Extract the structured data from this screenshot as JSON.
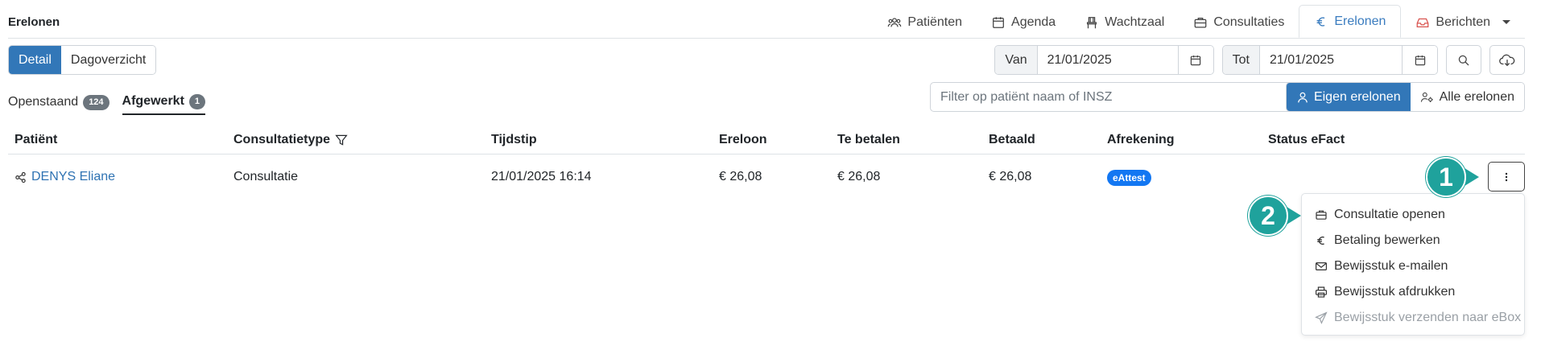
{
  "header": {
    "title": "Erelonen",
    "tabs": [
      {
        "label": "Patiënten",
        "icon": "users-icon",
        "active": false
      },
      {
        "label": "Agenda",
        "icon": "calendar-icon",
        "active": false
      },
      {
        "label": "Wachtzaal",
        "icon": "chair-icon",
        "active": false
      },
      {
        "label": "Consultaties",
        "icon": "briefcase-icon",
        "active": false
      },
      {
        "label": "Erelonen",
        "icon": "euro-icon",
        "active": true
      },
      {
        "label": "Berichten",
        "icon": "inbox-icon",
        "active": false,
        "dropdown": true
      }
    ]
  },
  "view_toggle": {
    "detail": "Detail",
    "dagoverzicht": "Dagoverzicht",
    "selected": "Detail"
  },
  "date_range": {
    "from_label": "Van",
    "from_value": "21/01/2025",
    "to_label": "Tot",
    "to_value": "21/01/2025"
  },
  "subtabs": [
    {
      "label": "Openstaand",
      "count": "124",
      "active": false
    },
    {
      "label": "Afgewerkt",
      "count": "1",
      "active": true
    }
  ],
  "filter": {
    "placeholder": "Filter op patiënt naam of INSZ"
  },
  "ownership": {
    "own_label": "Eigen erelonen",
    "all_label": "Alle erelonen",
    "selected": "Eigen erelonen"
  },
  "table": {
    "headers": [
      "Patiënt",
      "Consultatietype",
      "Tijdstip",
      "Ereloon",
      "Te betalen",
      "Betaald",
      "Afrekening",
      "Status eFact"
    ],
    "rows": [
      {
        "patient": "DENYS Eliane",
        "type": "Consultatie",
        "time": "21/01/2025 16:14",
        "fee": "€ 26,08",
        "to_pay": "€ 26,08",
        "paid": "€ 26,08",
        "settlement": "eAttest",
        "efact_status": ""
      }
    ]
  },
  "row_menu": {
    "items": [
      {
        "label": "Consultatie openen",
        "icon": "briefcase-icon",
        "disabled": false
      },
      {
        "label": "Betaling bewerken",
        "icon": "euro-icon",
        "disabled": false
      },
      {
        "label": "Bewijsstuk e-mailen",
        "icon": "envelope-icon",
        "disabled": false
      },
      {
        "label": "Bewijsstuk afdrukken",
        "icon": "printer-icon",
        "disabled": false
      },
      {
        "label": "Bewijsstuk verzenden naar eBox",
        "icon": "send-icon",
        "disabled": true
      }
    ]
  },
  "callouts": {
    "step1": "1",
    "step2": "2"
  },
  "colors": {
    "primary": "#3277b8",
    "link": "#2f73b3",
    "pill": "#1377f2",
    "callout": "#1fa29c",
    "badge": "#6c757d"
  }
}
